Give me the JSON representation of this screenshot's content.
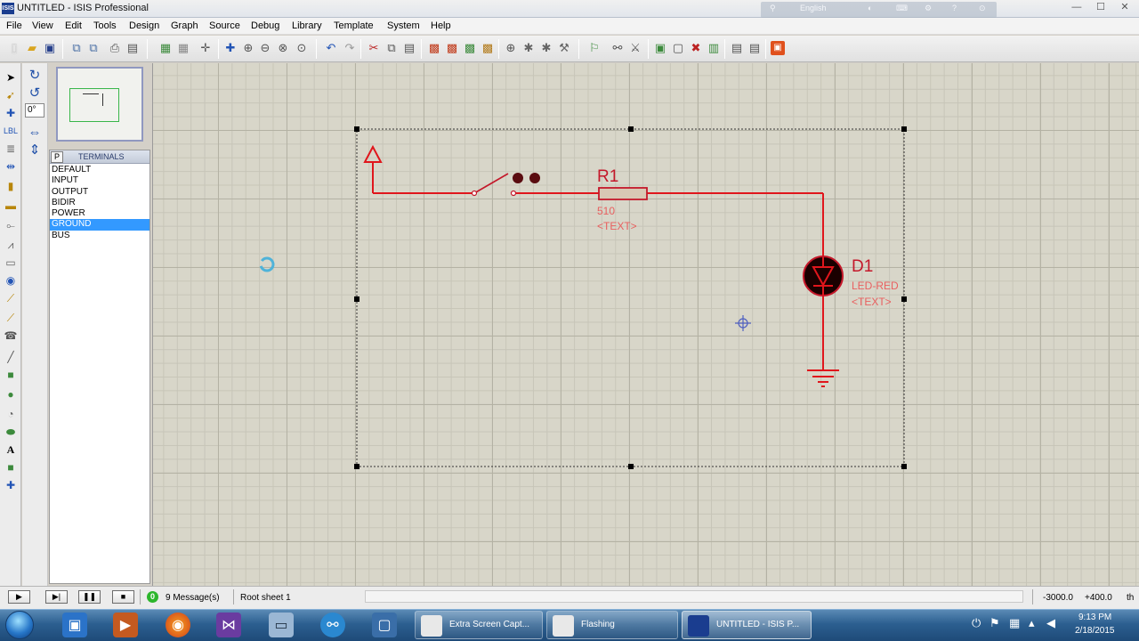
{
  "window": {
    "title": "UNTITLED - ISIS Professional",
    "app_icon_text": "ISIS",
    "ime_language": "English",
    "minimize_icon": "minimize-icon",
    "maximize_icon": "maximize-icon",
    "close_icon": "close-icon"
  },
  "menu": [
    "File",
    "View",
    "Edit",
    "Tools",
    "Design",
    "Graph",
    "Source",
    "Debug",
    "Library",
    "Template",
    "System",
    "Help"
  ],
  "rotation": {
    "angle": "0°"
  },
  "selector": {
    "toggle_label": "P",
    "header": "TERMINALS",
    "items": [
      "DEFAULT",
      "INPUT",
      "OUTPUT",
      "BIDIR",
      "POWER",
      "GROUND",
      "BUS"
    ],
    "selected": "GROUND"
  },
  "schematic": {
    "resistor": {
      "ref": "R1",
      "value": "510",
      "text": "<TEXT>"
    },
    "led": {
      "ref": "D1",
      "value": "LED-RED",
      "text": "<TEXT>"
    },
    "wire_color": "#e0161c",
    "component_outline_color": "#c4182a",
    "led_body_color": "#1a0000",
    "label_color": "#e86060"
  },
  "status": {
    "messages": "9 Message(s)",
    "message_indicator": "0",
    "sheet": "Root sheet 1",
    "coord_x": "-3000.0",
    "coord_y": "+400.0",
    "unit": "th"
  },
  "taskbar": {
    "tasks": [
      {
        "label": "Extra Screen Capt...",
        "active": false
      },
      {
        "label": "Flashing",
        "active": false
      },
      {
        "label": "UNTITLED - ISIS P...",
        "active": true
      }
    ],
    "clock_time": "9:13 PM",
    "clock_date": "2/18/2015"
  }
}
